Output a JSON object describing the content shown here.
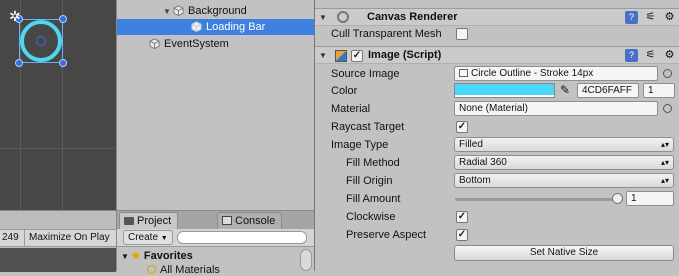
{
  "hierarchy": {
    "items": [
      {
        "label": "Background",
        "selected": false
      },
      {
        "label": "Loading Bar",
        "selected": true
      },
      {
        "label": "EventSystem",
        "selected": false
      }
    ]
  },
  "game_toolbar": {
    "resolution_fragment": "249",
    "maximize_label": "Maximize On Play"
  },
  "project": {
    "tabs": [
      {
        "label": "Project",
        "icon": "folder-icon"
      },
      {
        "label": "Console",
        "icon": "console-icon"
      }
    ],
    "create_label": "Create",
    "favorites_label": "Favorites",
    "favorites_items": [
      "All Materials"
    ]
  },
  "inspector": {
    "canvas_renderer": {
      "title": "Canvas Renderer",
      "cull_label": "Cull Transparent Mesh",
      "cull_checked": false
    },
    "image": {
      "title": "Image (Script)",
      "enabled": true,
      "source_image_label": "Source Image",
      "source_image_value": "Circle Outline - Stroke 14px",
      "color_label": "Color",
      "color_hex": "4CD6FAFF",
      "color_swatch": "#4CD6FA",
      "color_alpha": "1",
      "material_label": "Material",
      "material_value": "None (Material)",
      "raycast_label": "Raycast Target",
      "raycast_checked": true,
      "image_type_label": "Image Type",
      "image_type_value": "Filled",
      "fill_method_label": "Fill Method",
      "fill_method_value": "Radial 360",
      "fill_origin_label": "Fill Origin",
      "fill_origin_value": "Bottom",
      "fill_amount_label": "Fill Amount",
      "fill_amount_value": "1",
      "clockwise_label": "Clockwise",
      "clockwise_checked": true,
      "preserve_aspect_label": "Preserve Aspect",
      "preserve_aspect_checked": true,
      "set_native_size_label": "Set Native Size"
    }
  },
  "colors": {
    "selection": "#3d80df",
    "accent_cyan": "#4CD6FA"
  }
}
